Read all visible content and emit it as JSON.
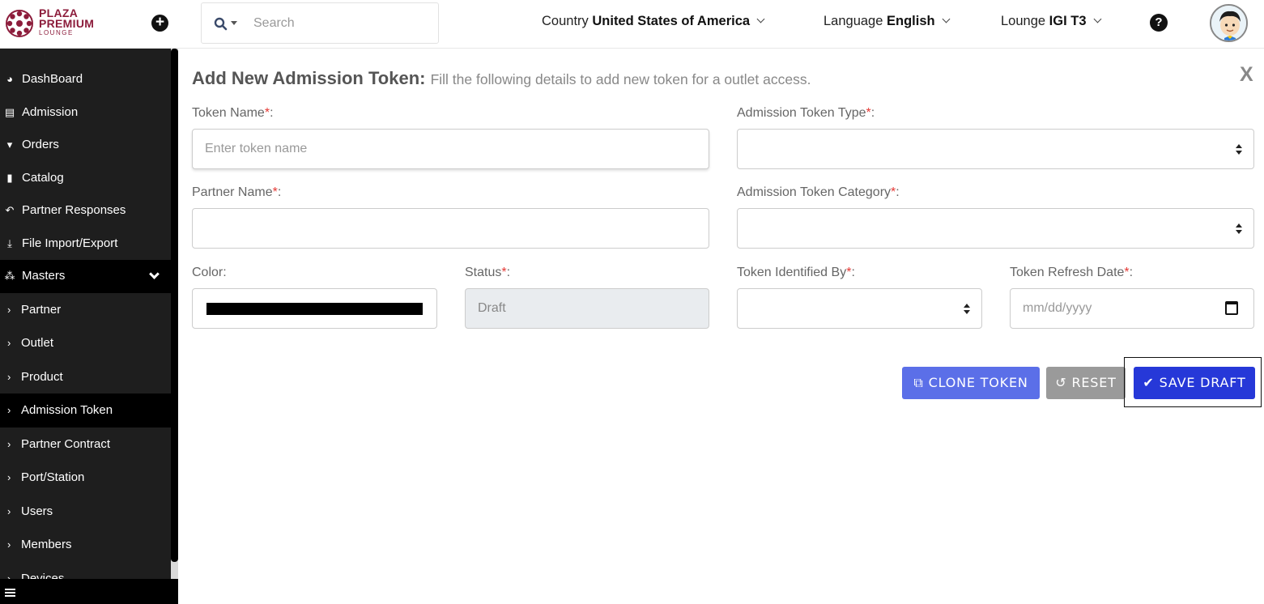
{
  "header": {
    "logo": {
      "line1": "PLAZA",
      "line2": "PREMIUM",
      "line3": "LOUNGE"
    },
    "search": {
      "placeholder": "Search"
    },
    "country": {
      "label": "Country",
      "value": "United States of America"
    },
    "language": {
      "label": "Language",
      "value": "English"
    },
    "lounge": {
      "label": "Lounge",
      "value": "IGI T3"
    },
    "help_icon": "?",
    "plus_icon": "+"
  },
  "sidebar": {
    "items": [
      {
        "label": "DashBoard",
        "icon": "dashboard-icon"
      },
      {
        "label": "Admission",
        "icon": "id-card-icon"
      },
      {
        "label": "Orders",
        "icon": "cart-icon"
      },
      {
        "label": "Catalog",
        "icon": "file-icon"
      },
      {
        "label": "Partner Responses",
        "icon": "reply-all-icon"
      },
      {
        "label": "File Import/Export",
        "icon": "download-icon"
      }
    ],
    "section": {
      "label": "Masters",
      "icon": "sitemap-icon"
    },
    "sub_items": [
      {
        "label": "Partner"
      },
      {
        "label": "Outlet"
      },
      {
        "label": "Product"
      },
      {
        "label": "Admission Token",
        "active": true
      },
      {
        "label": "Partner Contract"
      },
      {
        "label": "Port/Station"
      },
      {
        "label": "Users"
      },
      {
        "label": "Members"
      },
      {
        "label": "Devices"
      }
    ]
  },
  "form": {
    "title": "Add New Admission Token:",
    "subtitle": "Fill the following details to add new token for a outlet access.",
    "close": "X",
    "token_name": {
      "label": "Token Name",
      "placeholder": "Enter token name",
      "value": ""
    },
    "admission_token_type": {
      "label": "Admission Token Type",
      "value": ""
    },
    "partner_name": {
      "label": "Partner Name",
      "value": ""
    },
    "admission_token_category": {
      "label": "Admission Token Category",
      "value": ""
    },
    "color": {
      "label": "Color",
      "value": "#000000"
    },
    "status": {
      "label": "Status",
      "value": "Draft"
    },
    "token_identified_by": {
      "label": "Token Identified By",
      "value": ""
    },
    "token_refresh_date": {
      "label": "Token Refresh Date",
      "placeholder": "mm/dd/yyyy"
    },
    "required_mark": "*",
    "colon": ":",
    "buttons": {
      "clone": "CLONE TOKEN",
      "reset": "RESET",
      "save": "SAVE DRAFT"
    }
  },
  "colors": {
    "brand": "#8c1c3b",
    "sidebar_bg": "#1e1e1e",
    "clone_btn": "#5b6fe8",
    "reset_btn": "#9a9a9a",
    "save_btn": "#2638d8",
    "required": "#e53935"
  }
}
